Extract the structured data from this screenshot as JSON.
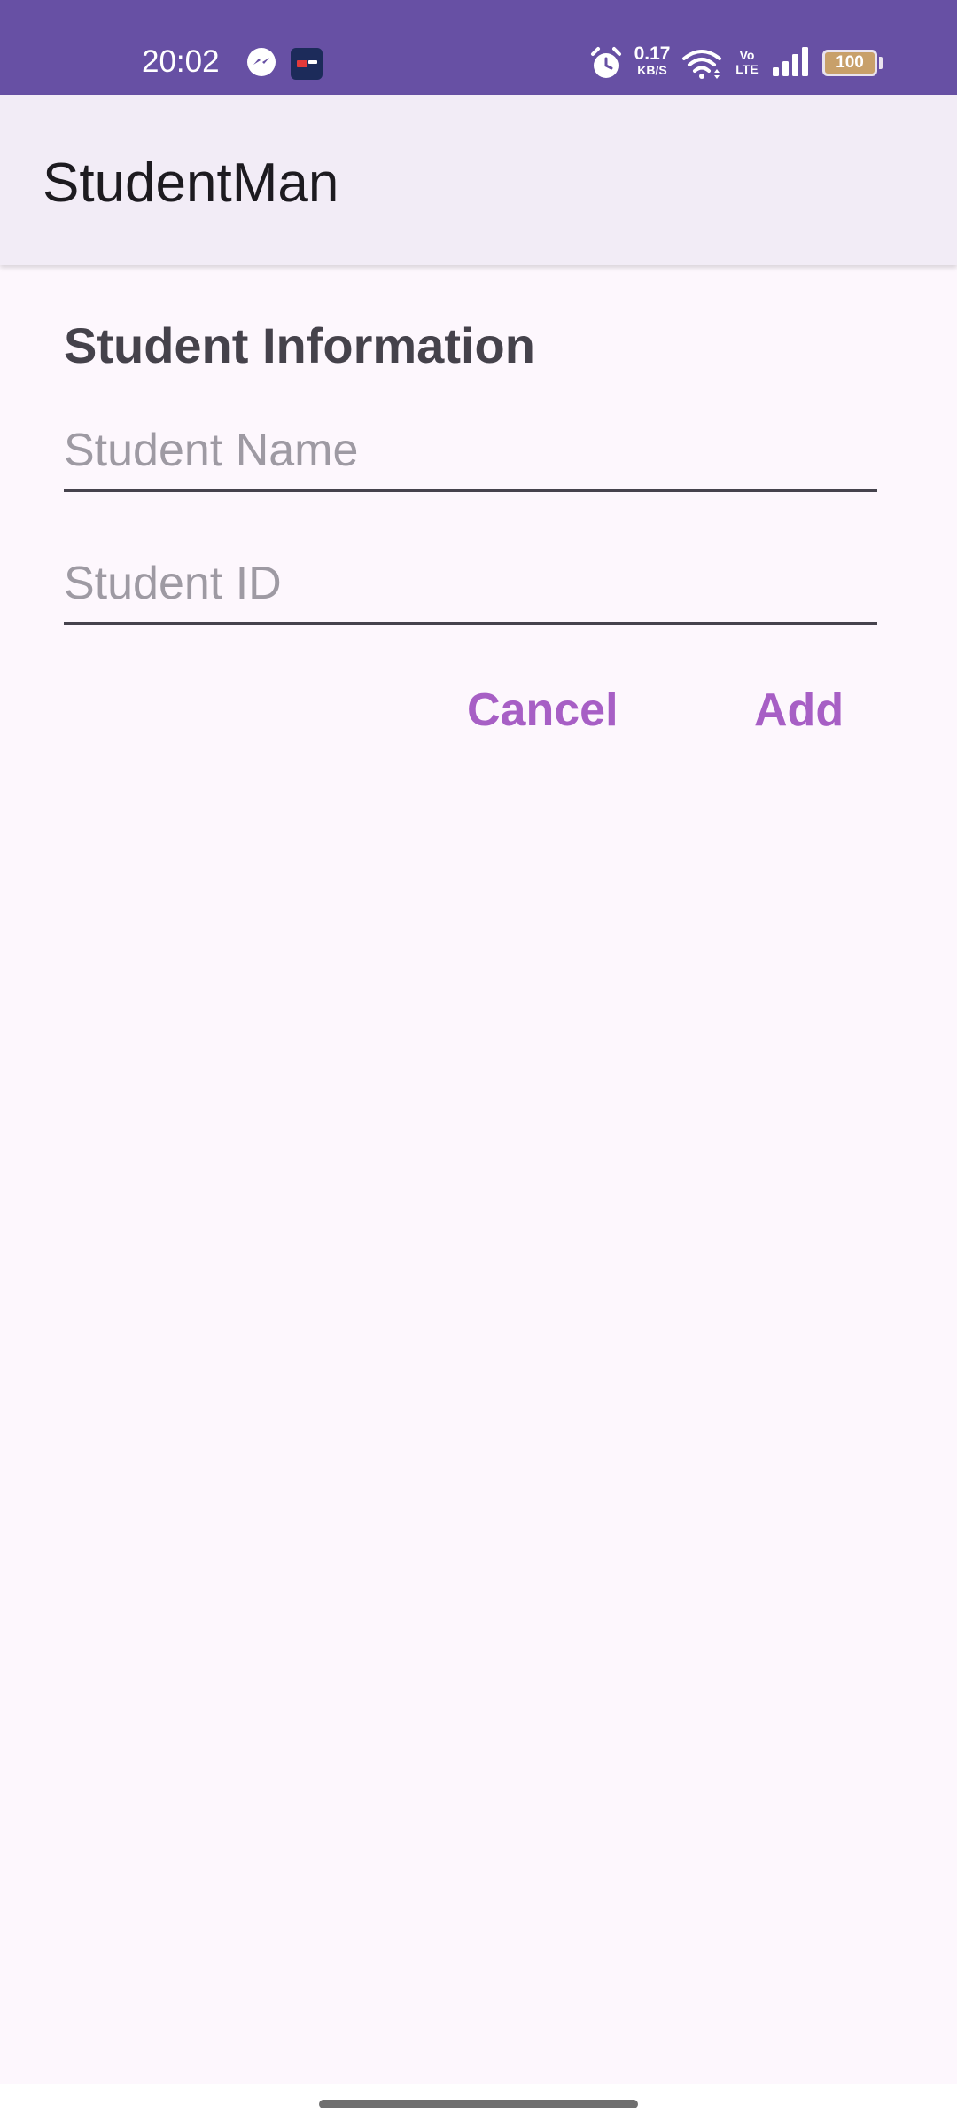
{
  "status_bar": {
    "time": "20:02",
    "net_speed_value": "0.17",
    "net_speed_unit": "KB/S",
    "volte_top": "Vo",
    "volte_bottom": "LTE",
    "battery_level": "100",
    "icons": [
      "messenger-icon",
      "app-notification-icon",
      "alarm-icon",
      "wifi-icon",
      "signal-icon",
      "battery-icon"
    ]
  },
  "app_bar": {
    "title": "StudentMan"
  },
  "form": {
    "section_title": "Student Information",
    "name_field": {
      "placeholder": "Student Name",
      "value": ""
    },
    "id_field": {
      "placeholder": "Student ID",
      "value": ""
    },
    "cancel_label": "Cancel",
    "add_label": "Add"
  },
  "colors": {
    "status_bar": "#6750a4",
    "app_bar": "#f2ecf6",
    "background": "#fdf7fd",
    "accent": "#a75fc5"
  }
}
